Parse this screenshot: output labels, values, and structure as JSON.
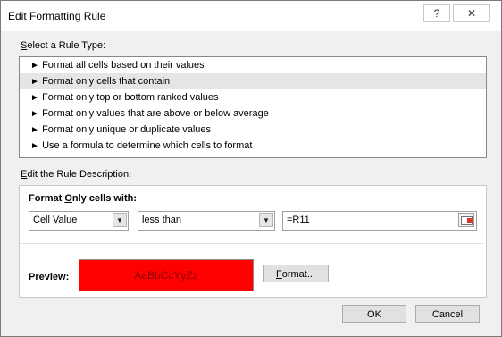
{
  "window": {
    "title": "Edit Formatting Rule",
    "help_glyph": "?",
    "close_glyph": "✕"
  },
  "rule_type": {
    "label_accel": "S",
    "label_rest": "elect a Rule Type:",
    "arrow_glyph": "►",
    "items": [
      {
        "label": "Format all cells based on their values"
      },
      {
        "label": "Format only cells that contain",
        "selected": true
      },
      {
        "label": "Format only top or bottom ranked values"
      },
      {
        "label": "Format only values that are above or below average"
      },
      {
        "label": "Format only unique or duplicate values"
      },
      {
        "label": "Use a formula to determine which cells to format"
      }
    ]
  },
  "description": {
    "label_accel": "E",
    "label_rest": "dit the Rule Description:",
    "heading_accel": "O",
    "heading_pre": "Format ",
    "heading_post": "nly cells with:",
    "cell_combo_value": "Cell Value",
    "operator_combo_value": "less than",
    "formula_value": "=R11",
    "dropdown_glyph": "▼",
    "preview_label": "Preview:",
    "preview_sample": "AaBbCcYyZz",
    "format_button_accel": "F",
    "format_button_rest": "ormat...",
    "preview_fill_color": "#ff0000"
  },
  "buttons": {
    "ok": "OK",
    "cancel": "Cancel"
  }
}
